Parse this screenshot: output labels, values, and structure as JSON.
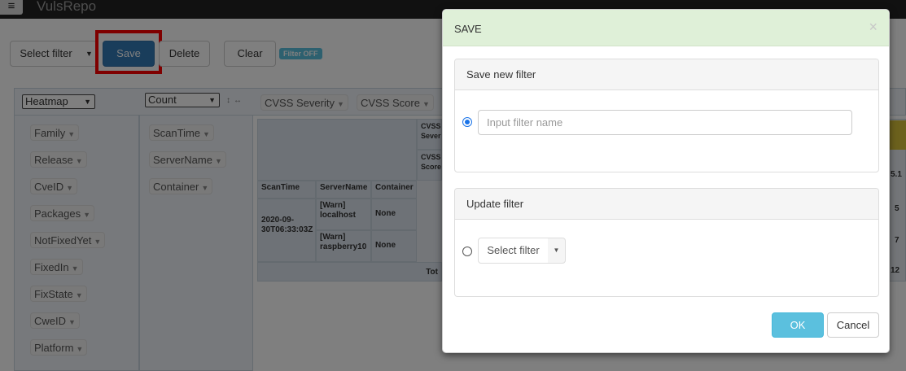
{
  "app": {
    "title": "VulsRepo",
    "menu_icon": "hamburger-icon"
  },
  "toolbar": {
    "select_filter_label": "Select filter",
    "save_label": "Save",
    "delete_label": "Delete",
    "clear_label": "Clear",
    "filter_status": "Filter OFF"
  },
  "pivot": {
    "renderer": "Heatmap",
    "aggregator": "Count",
    "col_attrs": [
      "CVSS Severity",
      "CVSS Score"
    ],
    "unused_attrs": [
      "Family",
      "Release",
      "CveID",
      "Packages",
      "NotFixedYet",
      "FixedIn",
      "FixState",
      "CweID",
      "Platform"
    ],
    "row_attrs": [
      "ScanTime",
      "ServerName",
      "Container"
    ],
    "table": {
      "col_header_1": "CVSS Sever",
      "col_header_2": "CVSS Score",
      "headers": [
        "ScanTime",
        "ServerName",
        "Container"
      ],
      "scan_time": "2020-09-30T06:33:03Z",
      "rows": [
        {
          "server": "[Warn] localhost",
          "container": "None"
        },
        {
          "server": "[Warn] raspberry10",
          "container": "None"
        }
      ],
      "total_label": "Tot",
      "right_values": [
        "5.1",
        "5",
        "7",
        "12"
      ]
    }
  },
  "modal": {
    "title": "SAVE",
    "close_symbol": "×",
    "save_new": {
      "heading": "Save new filter",
      "placeholder": "Input filter name",
      "selected": true
    },
    "update": {
      "heading": "Update filter",
      "select_label": "Select filter",
      "selected": false
    },
    "ok_label": "OK",
    "cancel_label": "Cancel"
  }
}
